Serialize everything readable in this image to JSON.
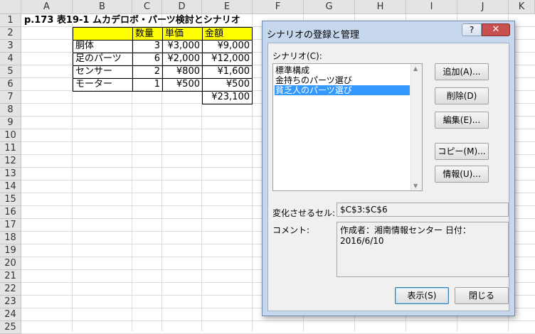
{
  "columns": [
    "A",
    "B",
    "C",
    "D",
    "E",
    "F",
    "G",
    "H",
    "I",
    "J",
    "K"
  ],
  "rows": [
    "1",
    "2",
    "3",
    "4",
    "5",
    "6",
    "7",
    "8",
    "9",
    "10",
    "11",
    "12",
    "13",
    "14",
    "15",
    "16",
    "17",
    "18",
    "19",
    "20",
    "21",
    "22",
    "23",
    "24",
    "25"
  ],
  "sheet": {
    "title": "p.173 表19-1 ムカデロボ・パーツ検討とシナリオ",
    "header": {
      "qty": "数量",
      "price": "単価",
      "amount": "金額"
    },
    "items": [
      {
        "name": "胴体",
        "qty": "3",
        "price": "¥3,000",
        "amount": "¥9,000"
      },
      {
        "name": "足のパーツ",
        "qty": "6",
        "price": "¥2,000",
        "amount": "¥12,000"
      },
      {
        "name": "センサー",
        "qty": "2",
        "price": "¥800",
        "amount": "¥1,600"
      },
      {
        "name": "モーター",
        "qty": "1",
        "price": "¥500",
        "amount": "¥500"
      }
    ],
    "total": "¥23,100"
  },
  "dialog": {
    "title": "シナリオの登録と管理",
    "help": "?",
    "close": "✕",
    "scenario_label": "シナリオ(C):",
    "scenarios": [
      "標準構成",
      "金持ちのパーツ選び",
      "貧乏人のパーツ選び"
    ],
    "selected_index": 2,
    "buttons": {
      "add": "追加(A)...",
      "delete": "削除(D)",
      "edit": "編集(E)...",
      "copy": "コピー(M)...",
      "info": "情報(U)..."
    },
    "changing_cells_label": "変化させるセル:",
    "changing_cells_value": "$C$3:$C$6",
    "comment_label": "コメント:",
    "comment_value": "作成者：湘南情報センター 日付：2016/6/10",
    "show": "表示(S)",
    "close_button": "閉じる"
  }
}
